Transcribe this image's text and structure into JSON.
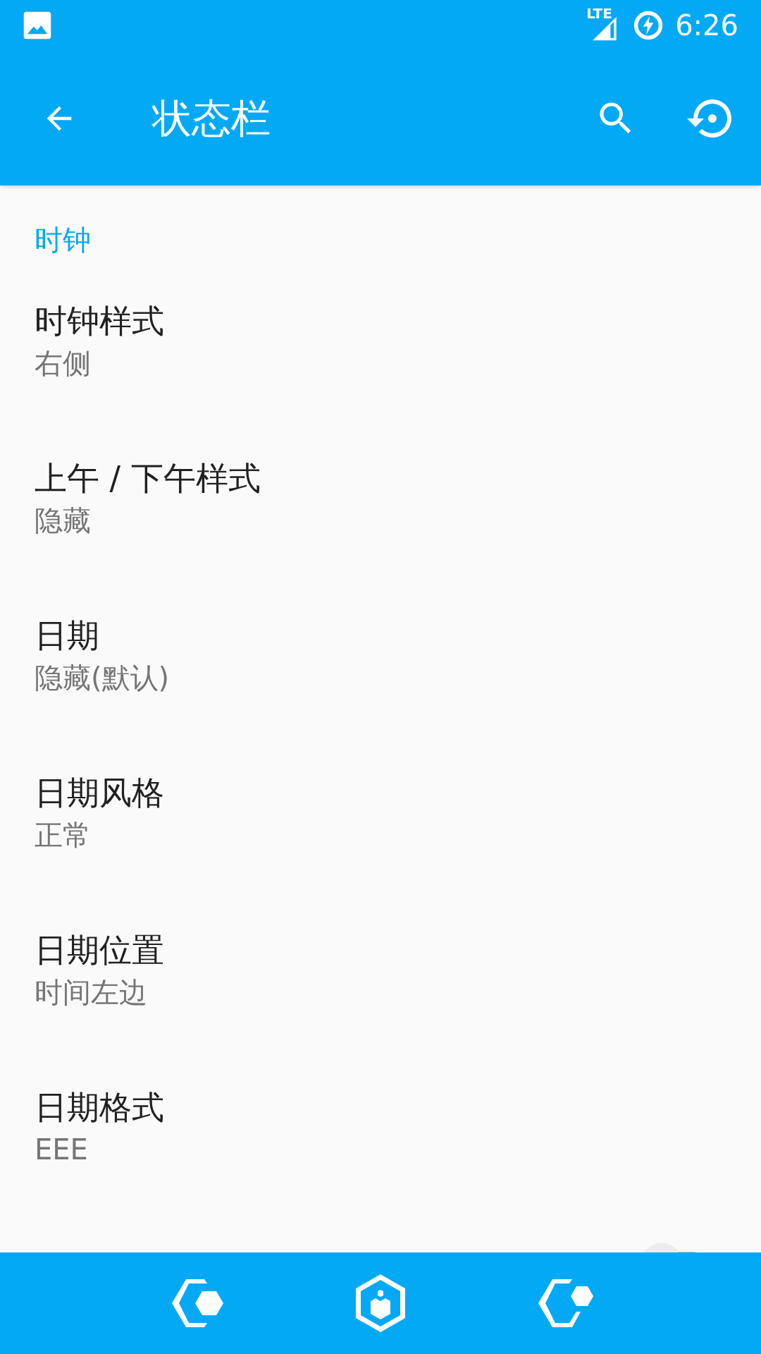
{
  "status_bar": {
    "network": "LTE",
    "time": "6:26"
  },
  "app_bar": {
    "title": "状态栏"
  },
  "section": {
    "header": "时钟"
  },
  "items": [
    {
      "title": "时钟样式",
      "summary": "右侧"
    },
    {
      "title": "上午 / 下午样式",
      "summary": "隐藏"
    },
    {
      "title": "日期",
      "summary": "隐藏(默认)"
    },
    {
      "title": "日期风格",
      "summary": "正常"
    },
    {
      "title": "日期位置",
      "summary": "时间左边"
    },
    {
      "title": "日期格式",
      "summary": "EEE"
    }
  ],
  "partial_row": {
    "on": false
  }
}
